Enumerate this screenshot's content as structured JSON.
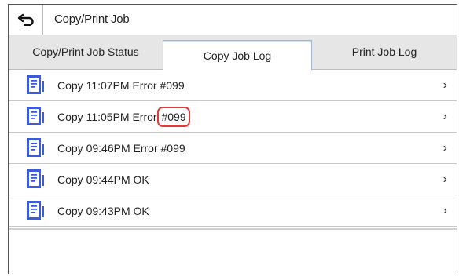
{
  "header": {
    "title": "Copy/Print Job",
    "back_icon": "back-arrow-icon"
  },
  "tabs": [
    {
      "label": "Copy/Print Job Status",
      "selected": false
    },
    {
      "label": "Copy Job Log",
      "selected": true
    },
    {
      "label": "Print Job Log",
      "selected": false
    }
  ],
  "job_log": [
    {
      "prefix": "Copy 11:07PM Error #099",
      "highlight": "",
      "icon": "copy-document-icon"
    },
    {
      "prefix": "Copy 11:05PM Error ",
      "highlight": "#099",
      "icon": "copy-document-icon"
    },
    {
      "prefix": "Copy 09:46PM Error #099",
      "highlight": "",
      "icon": "copy-document-icon"
    },
    {
      "prefix": "Copy 09:44PM OK",
      "highlight": "",
      "icon": "copy-document-icon"
    },
    {
      "prefix": "Copy 09:43PM OK",
      "highlight": "",
      "icon": "copy-document-icon"
    }
  ],
  "colors": {
    "highlight_circle": "#e53935",
    "icon_blue": "#3b5bd9",
    "tab_bar": "#e6e6e6"
  },
  "chevron": "›"
}
